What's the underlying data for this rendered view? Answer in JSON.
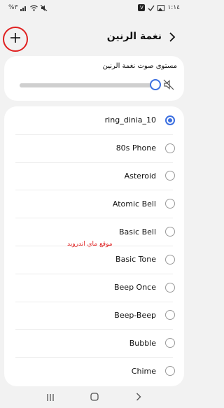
{
  "status_bar": {
    "time": "١:١٤",
    "battery": "%٣",
    "icons": [
      "signal-icon",
      "wifi-icon",
      "mute-icon",
      "check-icon",
      "box-v-icon"
    ]
  },
  "header": {
    "title": "نغمة الرنين",
    "add_icon": "plus-icon",
    "back_icon": "chevron-right-icon"
  },
  "volume": {
    "label": "مستوى صوت نغمة الرنين",
    "level": 1.0,
    "accent": "#3b6fe0"
  },
  "ringtones": {
    "selected_index": 0,
    "items": [
      {
        "label": "ring_dinia_10"
      },
      {
        "label": "80s Phone"
      },
      {
        "label": "Asteroid"
      },
      {
        "label": "Atomic Bell"
      },
      {
        "label": "Basic Bell"
      },
      {
        "label": "Basic Tone"
      },
      {
        "label": "Beep Once"
      },
      {
        "label": "Beep-Beep"
      },
      {
        "label": "Bubble"
      },
      {
        "label": "Chime"
      }
    ]
  },
  "watermark": "موقع ماي اندرويد",
  "nav": [
    "recents-icon",
    "home-icon",
    "back-icon"
  ],
  "colors": {
    "accent": "#3b6fe0",
    "highlight_circle": "#e02020"
  }
}
